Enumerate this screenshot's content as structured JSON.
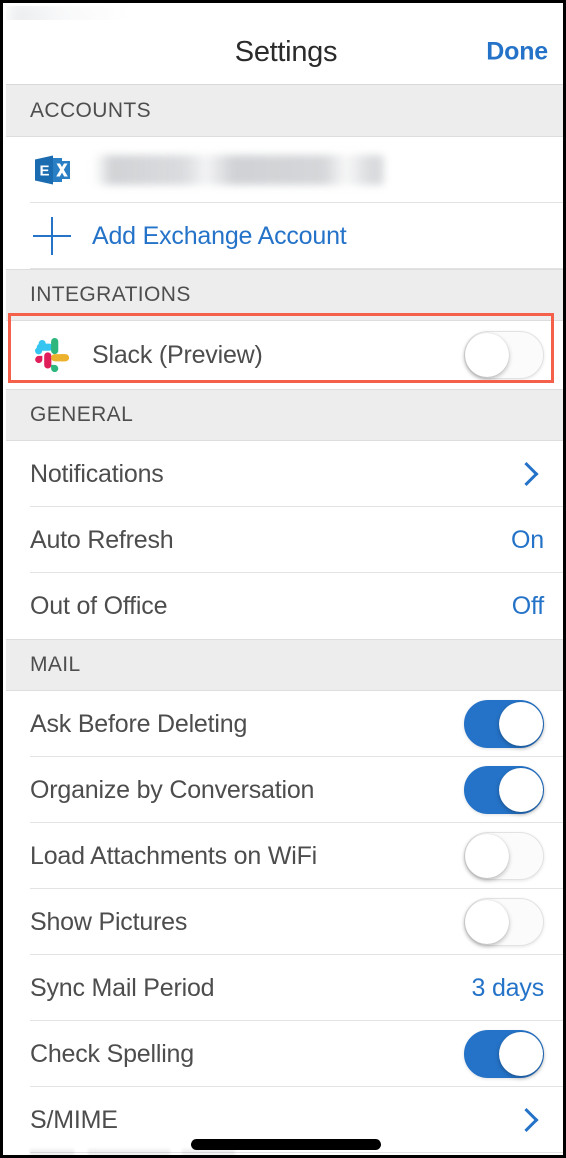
{
  "navbar": {
    "title": "Settings",
    "done_label": "Done"
  },
  "sections": [
    {
      "header": "ACCOUNTS",
      "rows": [
        {
          "name": "exchange-account-row",
          "icon": "exchange-icon",
          "label": "",
          "redacted": true,
          "accessory": "none"
        },
        {
          "name": "add-exchange-account-row",
          "icon": "plus-icon",
          "label": "Add Exchange Account",
          "link": true,
          "accessory": "none"
        }
      ]
    },
    {
      "header": "INTEGRATIONS",
      "rows": [
        {
          "name": "slack-integration-row",
          "icon": "slack-icon",
          "label": "Slack (Preview)",
          "accessory": "toggle",
          "toggle_state": "off",
          "highlighted": true
        }
      ]
    },
    {
      "header": "GENERAL",
      "rows": [
        {
          "name": "notifications-row",
          "label": "Notifications",
          "accessory": "chevron"
        },
        {
          "name": "auto-refresh-row",
          "label": "Auto Refresh",
          "accessory": "value",
          "value": "On"
        },
        {
          "name": "out-of-office-row",
          "label": "Out of Office",
          "accessory": "value",
          "value": "Off"
        }
      ]
    },
    {
      "header": "MAIL",
      "rows": [
        {
          "name": "ask-before-deleting-row",
          "label": "Ask Before Deleting",
          "accessory": "toggle",
          "toggle_state": "on"
        },
        {
          "name": "organize-by-conversation-row",
          "label": "Organize by Conversation",
          "accessory": "toggle",
          "toggle_state": "on"
        },
        {
          "name": "load-attachments-on-wifi-row",
          "label": "Load Attachments on WiFi",
          "accessory": "toggle",
          "toggle_state": "off"
        },
        {
          "name": "show-pictures-row",
          "label": "Show Pictures",
          "accessory": "toggle",
          "toggle_state": "off"
        },
        {
          "name": "sync-mail-period-row",
          "label": "Sync Mail Period",
          "accessory": "value",
          "value": "3 days"
        },
        {
          "name": "check-spelling-row",
          "label": "Check Spelling",
          "accessory": "toggle",
          "toggle_state": "on"
        },
        {
          "name": "smime-row",
          "label": "S/MIME",
          "accessory": "chevron"
        }
      ]
    }
  ],
  "colors": {
    "accent_blue": "#2573c8",
    "highlight_red": "#f4604a",
    "section_header_bg": "#ededed",
    "label_gray": "#4d4d4d"
  }
}
